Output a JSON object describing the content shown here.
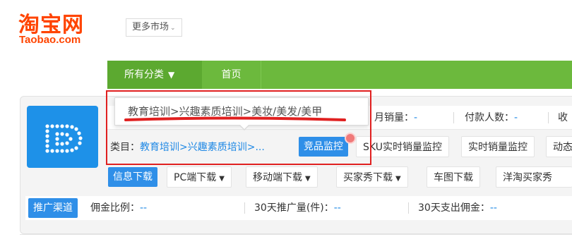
{
  "logo": {
    "cn": "淘宝网",
    "en": "Taobao.com"
  },
  "header": {
    "more_market": "更多市场"
  },
  "nav": {
    "all_categories": "所有分类",
    "home": "首页"
  },
  "stats": {
    "monthly_sales_label": "月销量：",
    "monthly_sales_value": "-",
    "buyers_label": "付款人数：",
    "buyers_value": "-",
    "more_label": "收"
  },
  "category": {
    "label": "类目：",
    "path_short": "教育培训>兴趣素质培训>..."
  },
  "tooltip": {
    "text": "教育培训>兴趣素质培训>美妆/美发/美甲"
  },
  "buttons": {
    "competitor_monitor": "竞品监控",
    "sku_monitor": "SKU实时销量监控",
    "realtime_monitor": "实时销量监控",
    "dynamic": "动态"
  },
  "downloads": {
    "section": "信息下载",
    "pc": "PC端下载",
    "mobile": "移动端下载",
    "buyer_show": "买家秀下载",
    "car_image": "车图下载",
    "foreign_buyer": "洋淘买家秀"
  },
  "promo": {
    "section": "推广渠道",
    "commission_label": "佣金比例：",
    "commission_value": "--",
    "promo_30d_label": "30天推广量(件)：",
    "promo_30d_value": "--",
    "spend_30d_label": "30天支出佣金：",
    "spend_30d_value": "--"
  },
  "colors": {
    "brand": "#ff4400",
    "nav_green": "#6cb93d",
    "accent_blue": "#1e88e5",
    "highlight_red": "#e02020"
  }
}
